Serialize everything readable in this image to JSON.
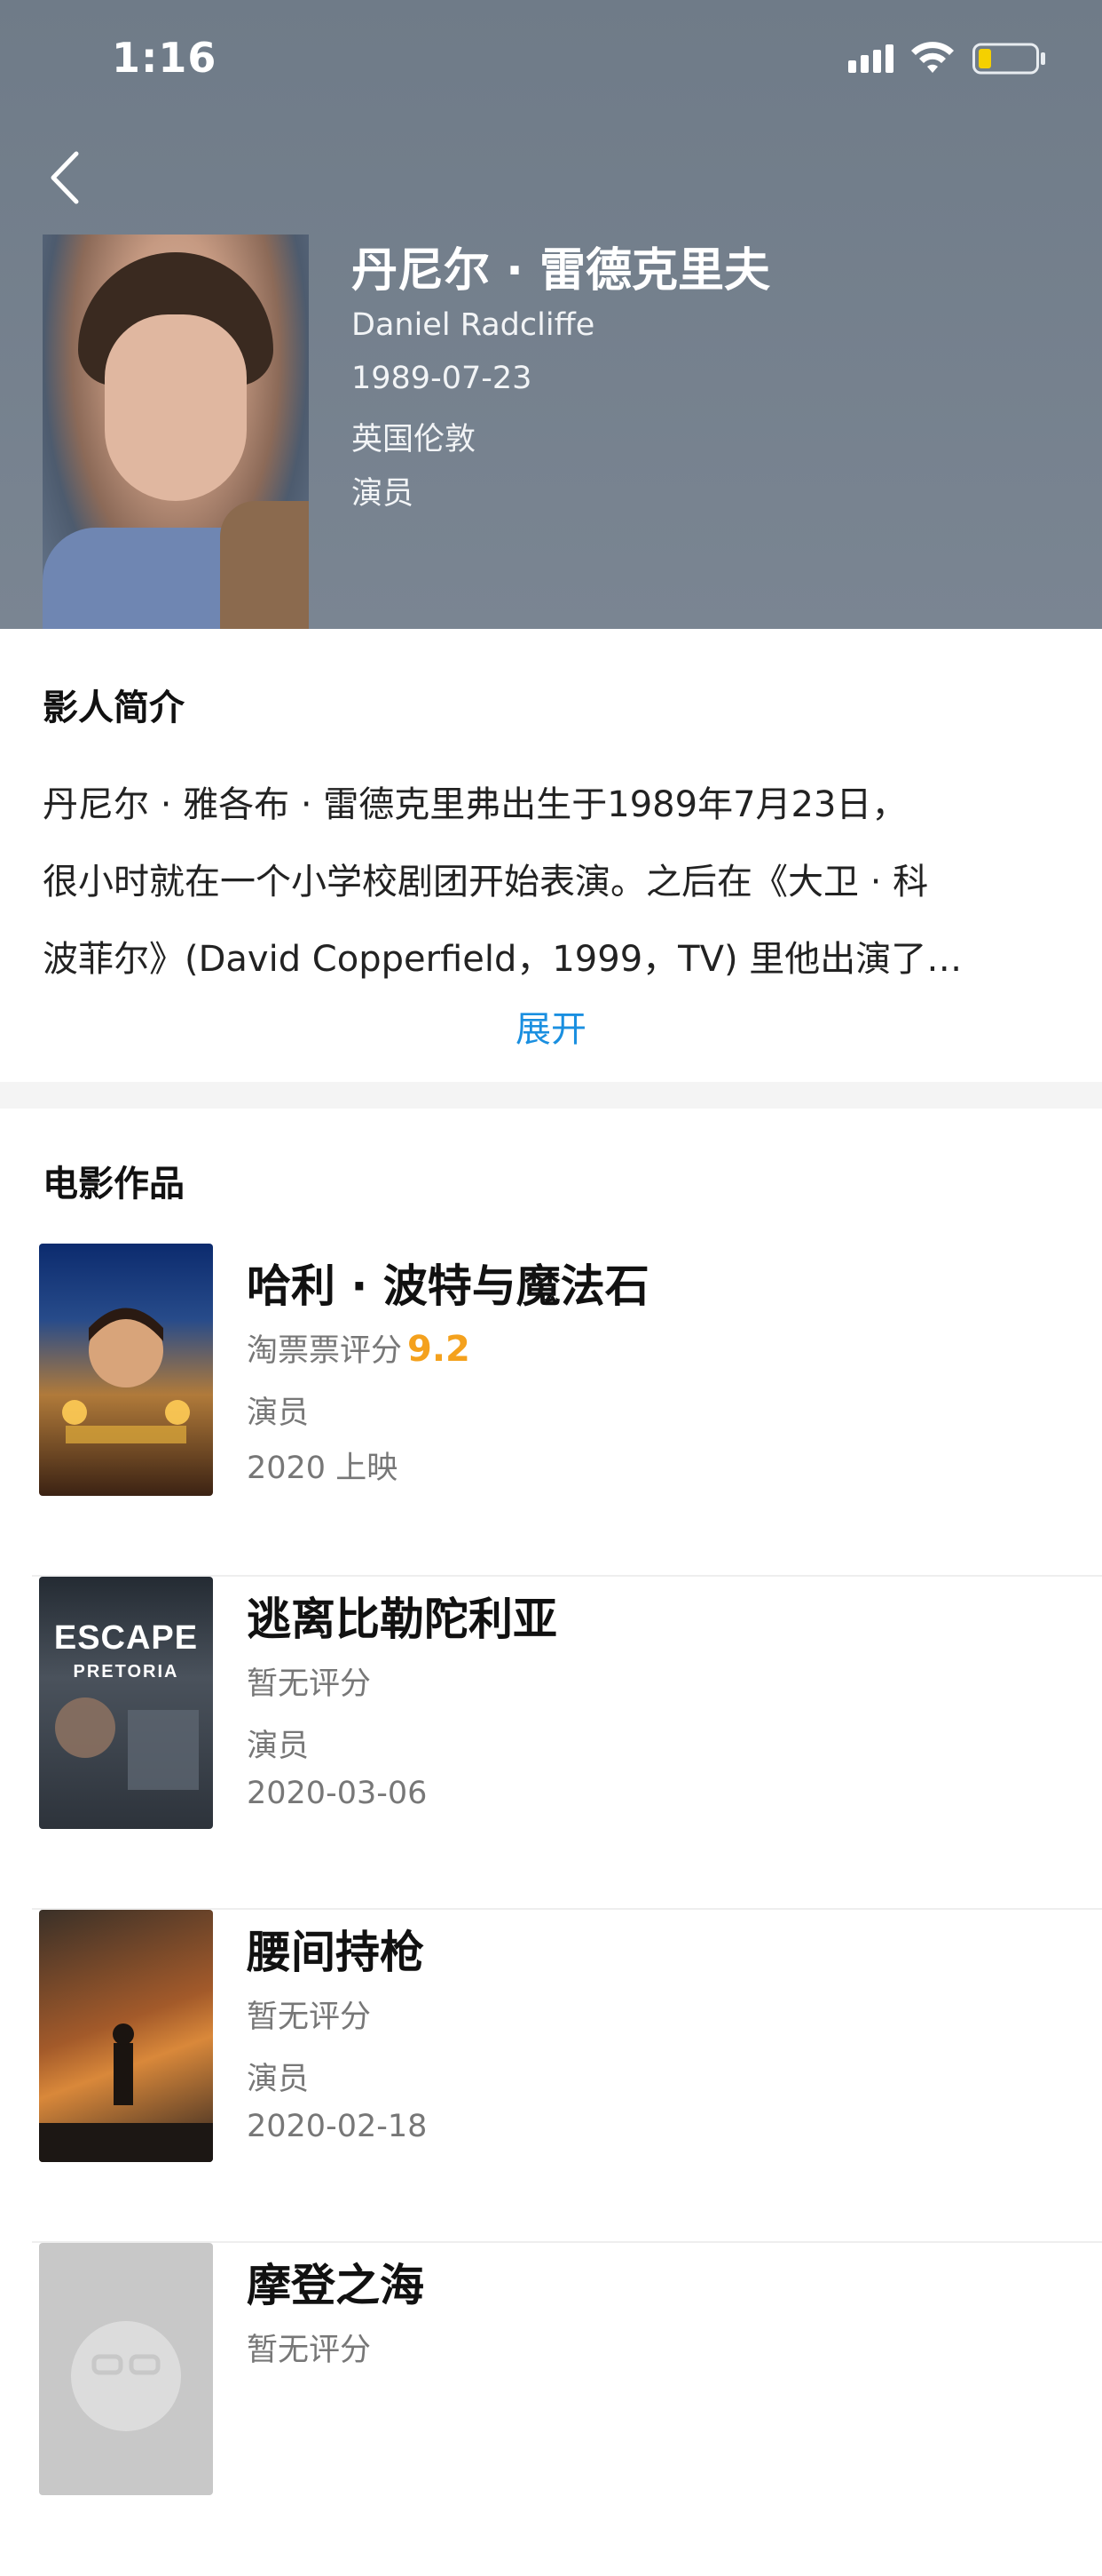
{
  "status_bar": {
    "time": "1:16"
  },
  "actor": {
    "name_cn": "丹尼尔 · 雷德克里夫",
    "name_en": "Daniel Radcliffe",
    "birth_date": "1989-07-23",
    "birthplace": "英国伦敦",
    "profession": "演员"
  },
  "intro": {
    "title": "影人简介",
    "lines": [
      "丹尼尔 · 雅各布 · 雷德克里弗出生于1989年7月23日，",
      "很小时就在一个小学校剧团开始表演。之后在《大卫 · 科",
      "波菲尔》(David Copperfield，1999，TV) 里他出演了…"
    ],
    "expand_label": "展开"
  },
  "films_section": {
    "title": "电影作品",
    "items": [
      {
        "title": "哈利 · 波特与魔法石",
        "rating_label": "淘票票评分",
        "score": "9.2",
        "role": "演员",
        "date": "2020 上映"
      },
      {
        "title": "逃离比勒陀利亚",
        "rating_label": "暂无评分",
        "score": "",
        "role": "演员",
        "date": "2020-03-06",
        "poster_text": [
          "ESCAPE",
          "PRETORIA"
        ]
      },
      {
        "title": "腰间持枪",
        "rating_label": "暂无评分",
        "score": "",
        "role": "演员",
        "date": "2020-02-18"
      },
      {
        "title": "摩登之海",
        "rating_label": "暂无评分",
        "score": "",
        "role": "",
        "date": ""
      }
    ]
  },
  "colors": {
    "header_bg": "#74808d",
    "accent_blue": "#1a8fe0",
    "score_orange": "#f4a11d",
    "battery_low": "#f5d000"
  }
}
